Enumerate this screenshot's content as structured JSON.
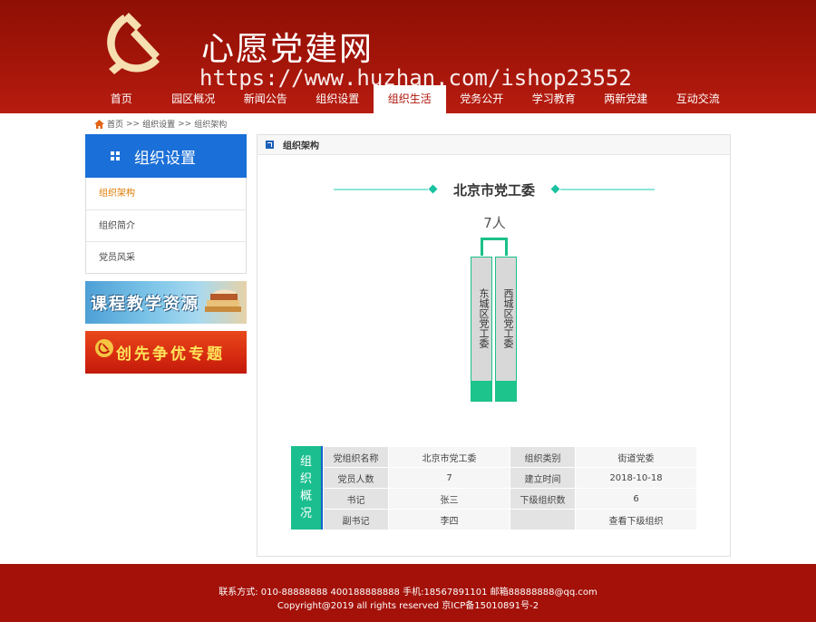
{
  "header": {
    "site_title": "心愿党建网",
    "watermark": "https://www.huzhan.com/ishop23552",
    "nav": [
      "首页",
      "园区概况",
      "新闻公告",
      "组织设置",
      "组织生活",
      "党务公开",
      "学习教育",
      "两新党建",
      "互动交流"
    ],
    "active_nav": "组织生活",
    "brand_color": "#a41509"
  },
  "breadcrumb": [
    "首页",
    ">>",
    "组织设置",
    ">>",
    "组织架构"
  ],
  "sidebar": {
    "title": "组织设置",
    "items": [
      "组织架构",
      "组织简介",
      "党员风采"
    ],
    "banners": [
      "课程教学资源",
      "创先争优专题"
    ]
  },
  "panel": {
    "title": "组织架构",
    "org_name": "北京市党工委",
    "member_count": "7人",
    "sub_orgs": [
      "东城区党工委",
      "西城区党工委"
    ]
  },
  "info": {
    "side_label": [
      "组",
      "织",
      "概",
      "况"
    ],
    "rows": [
      [
        "党组织名称",
        "北京市党工委",
        "组织类别",
        "街道党委"
      ],
      [
        "党员人数",
        "7",
        "建立时间",
        "2018-10-18"
      ],
      [
        "书记",
        "张三",
        "下级组织数",
        "6"
      ],
      [
        "副书记",
        "李四",
        "",
        "查看下级组织"
      ]
    ]
  },
  "footer": {
    "contact": "联系方式: 010-88888888 400188888888 手机:18567891101 邮箱88888888@qq.com",
    "copyright": "Copyright@2019 all rights reserved 京ICP备15010891号-2"
  }
}
